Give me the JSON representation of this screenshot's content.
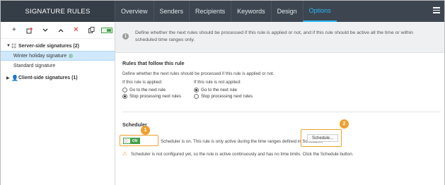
{
  "app": {
    "sidebar_title": "SIGNATURE RULES"
  },
  "tabs": [
    "Overview",
    "Senders",
    "Recipients",
    "Keywords",
    "Design",
    "Options"
  ],
  "active_tab": "Options",
  "toolbar": {
    "add": "+",
    "delete": "✕"
  },
  "sidebar": {
    "server_group": "Server-side signatures (2)",
    "items": [
      "Winter holiday signature",
      "Standard signature"
    ],
    "client_group": "Client-side signatures (1)"
  },
  "info": {
    "text": "Define whether the next rules should be processed if this rule is applied or not, and if this rule should be active all the time or within scheduled time ranges only."
  },
  "rules_follow": {
    "title": "Rules that follow this rule",
    "description": "Define whether the next rules should be processed if this rule is applied or not.",
    "applied_label": "If this rule is applied:",
    "not_applied_label": "If this rule is not applied:",
    "applied_options": [
      "Go to the next rule",
      "Stop processing next rules"
    ],
    "not_applied_options": [
      "Go to the next rule",
      "Stop processing next rules"
    ],
    "applied_selected": 1,
    "not_applied_selected": 0
  },
  "scheduler": {
    "title": "Scheduler",
    "toggle_label": "ON",
    "status_text": "Scheduler is on. This rule is only active during the time ranges defined in Scheduler.",
    "button_label": "Schedule...",
    "warning": "Scheduler is not configured yet, so the rule is active continuously and has no time limits. Click the Schedule button."
  },
  "badges": [
    "1",
    "2"
  ],
  "colors": {
    "accent": "#29b6f6",
    "highlight": "#f0a030",
    "toggle_on": "#43a047"
  }
}
